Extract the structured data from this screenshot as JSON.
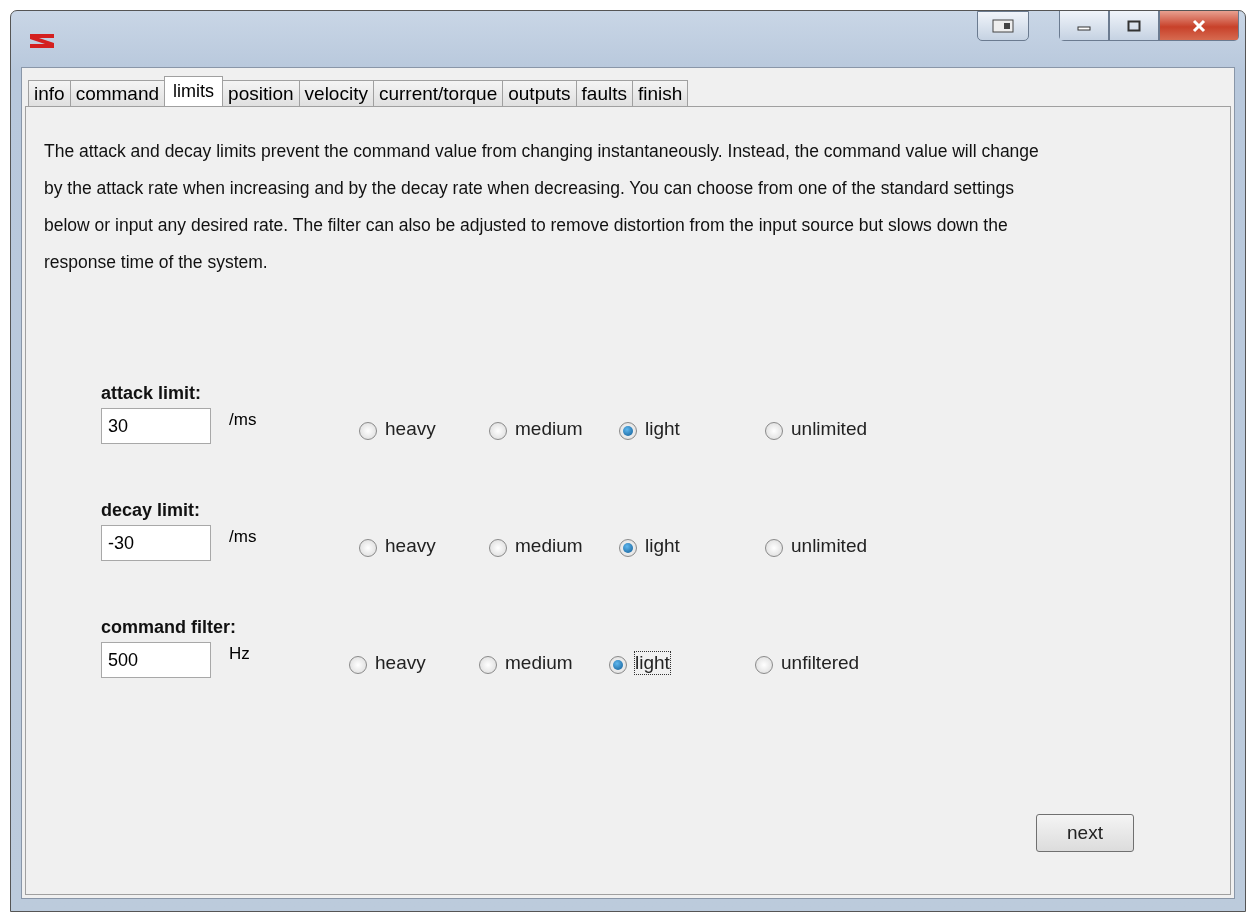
{
  "tabs": [
    {
      "label": "info",
      "selected": false
    },
    {
      "label": "command",
      "selected": false
    },
    {
      "label": "limits",
      "selected": true
    },
    {
      "label": "position",
      "selected": false
    },
    {
      "label": "velocity",
      "selected": false
    },
    {
      "label": "current/torque",
      "selected": false
    },
    {
      "label": "outputs",
      "selected": false
    },
    {
      "label": "faults",
      "selected": false
    },
    {
      "label": "finish",
      "selected": false
    }
  ],
  "description": "The attack and decay limits prevent the command value from changing instantaneously.  Instead, the command value will change by the attack rate when increasing and by the decay rate when decreasing.  You can choose from one of the standard settings below or input any desired rate.  The filter can also be adjusted to remove distortion from the input source but slows down the response time of the system.",
  "settings": [
    {
      "label": "attack limit:",
      "value": "30",
      "unit": "/ms",
      "options": [
        {
          "label": "heavy",
          "selected": false,
          "focused": false
        },
        {
          "label": "medium",
          "selected": false,
          "focused": false
        },
        {
          "label": "light",
          "selected": true,
          "focused": false
        },
        {
          "label": "unlimited",
          "selected": false,
          "focused": false
        }
      ]
    },
    {
      "label": "decay limit:",
      "value": "-30",
      "unit": "/ms",
      "options": [
        {
          "label": "heavy",
          "selected": false,
          "focused": false
        },
        {
          "label": "medium",
          "selected": false,
          "focused": false
        },
        {
          "label": "light",
          "selected": true,
          "focused": false
        },
        {
          "label": "unlimited",
          "selected": false,
          "focused": false
        }
      ]
    },
    {
      "label": "command filter:",
      "value": "500",
      "unit": "Hz",
      "options": [
        {
          "label": "heavy",
          "selected": false,
          "focused": false
        },
        {
          "label": "medium",
          "selected": false,
          "focused": false
        },
        {
          "label": "light",
          "selected": true,
          "focused": true
        },
        {
          "label": "unfiltered",
          "selected": false,
          "focused": false
        }
      ]
    }
  ],
  "next_button": "next"
}
